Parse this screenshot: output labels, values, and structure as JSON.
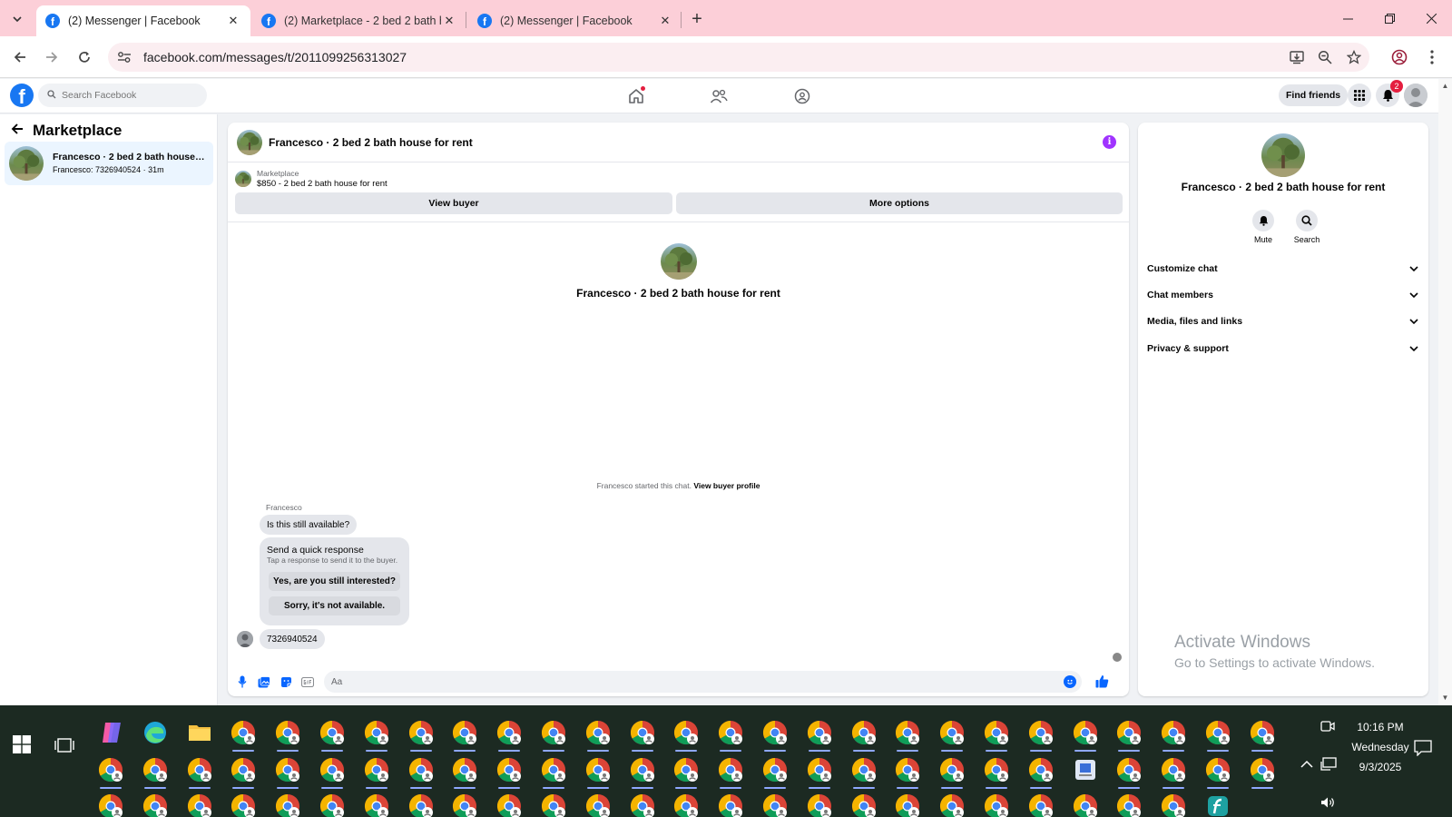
{
  "browser": {
    "tabs": [
      {
        "title": "(2) Messenger | Facebook",
        "active": true
      },
      {
        "title": "(2) Marketplace - 2 bed 2 bath h",
        "active": false
      },
      {
        "title": "(2) Messenger | Facebook",
        "active": false
      }
    ],
    "url": "facebook.com/messages/t/2011099256313027",
    "favicon_letter": "f"
  },
  "fb": {
    "logo_letter": "f",
    "search_placeholder": "Search Facebook",
    "find_friends": "Find friends",
    "notification_count": "2"
  },
  "left": {
    "title": "Marketplace",
    "conversations": [
      {
        "name": "Francesco · 2 bed 2 bath house for rent",
        "sub": "Francesco: 7326940524 · 31m"
      }
    ]
  },
  "chat": {
    "header_name": "Francesco · 2 bed 2 bath house for rent",
    "marketplace_label": "Marketplace",
    "listing": "$850 - 2 bed 2 bath house for rent",
    "view_buyer": "View buyer",
    "more_options": "More options",
    "profile_name": "Francesco · 2 bed 2 bath house for rent",
    "started_text": "Francesco started this chat.",
    "view_buyer_profile": "View buyer profile",
    "sender": "Francesco",
    "message1": "Is this still available?",
    "quick_title": "Send a quick response",
    "quick_sub": "Tap a response to send it to the buyer.",
    "quick_reply1": "Yes, are you still interested?",
    "quick_reply2": "Sorry, it's not available.",
    "message2": "7326940524",
    "composer_placeholder": "Aa"
  },
  "right": {
    "name": "Francesco · 2 bed 2 bath house for rent",
    "actions": [
      "Mute",
      "Search"
    ],
    "sections": [
      "Customize chat",
      "Chat members",
      "Media, files and links",
      "Privacy & support"
    ]
  },
  "watermark": {
    "line1": "Activate Windows",
    "line2": "Go to Settings to activate Windows."
  },
  "taskbar": {
    "time": "10:16 PM",
    "day": "Wednesday",
    "date": "9/3/2025"
  },
  "colors": {
    "tabbar_bg": "#fccfd8",
    "fb_blue": "#1877f2",
    "messenger_accent": "#0866ff",
    "info_purple": "#a033ff",
    "taskbar_bg": "#1c2a22"
  }
}
